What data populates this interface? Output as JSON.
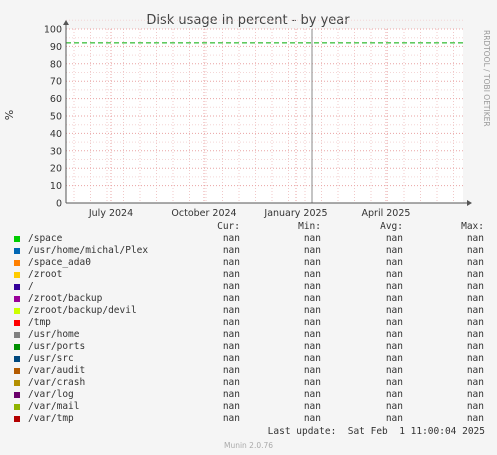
{
  "chart_data": {
    "type": "line",
    "title": "Disk usage in percent - by year",
    "ylabel": "%",
    "ylim": [
      0,
      100
    ],
    "yticks": [
      0,
      10,
      20,
      30,
      40,
      50,
      60,
      70,
      80,
      90,
      100
    ],
    "x_ticks": [
      "July 2024",
      "October 2024",
      "January 2025",
      "April 2025"
    ],
    "warning_line": 92,
    "grid": true,
    "series": [
      {
        "name": "/space",
        "color": "#00cc00",
        "cur": "nan",
        "min": "nan",
        "avg": "nan",
        "max": "nan"
      },
      {
        "name": "/usr/home/michal/Plex",
        "color": "#0066b3",
        "cur": "nan",
        "min": "nan",
        "avg": "nan",
        "max": "nan"
      },
      {
        "name": "/space_ada0",
        "color": "#ff8000",
        "cur": "nan",
        "min": "nan",
        "avg": "nan",
        "max": "nan"
      },
      {
        "name": "/zroot",
        "color": "#ffcc00",
        "cur": "nan",
        "min": "nan",
        "avg": "nan",
        "max": "nan"
      },
      {
        "name": "/",
        "color": "#330099",
        "cur": "nan",
        "min": "nan",
        "avg": "nan",
        "max": "nan"
      },
      {
        "name": "/zroot/backup",
        "color": "#990099",
        "cur": "nan",
        "min": "nan",
        "avg": "nan",
        "max": "nan"
      },
      {
        "name": "/zroot/backup/devil",
        "color": "#ccff00",
        "cur": "nan",
        "min": "nan",
        "avg": "nan",
        "max": "nan"
      },
      {
        "name": "/tmp",
        "color": "#ff0000",
        "cur": "nan",
        "min": "nan",
        "avg": "nan",
        "max": "nan"
      },
      {
        "name": "/usr/home",
        "color": "#808080",
        "cur": "nan",
        "min": "nan",
        "avg": "nan",
        "max": "nan"
      },
      {
        "name": "/usr/ports",
        "color": "#008f00",
        "cur": "nan",
        "min": "nan",
        "avg": "nan",
        "max": "nan"
      },
      {
        "name": "/usr/src",
        "color": "#00487d",
        "cur": "nan",
        "min": "nan",
        "avg": "nan",
        "max": "nan"
      },
      {
        "name": "/var/audit",
        "color": "#b35a00",
        "cur": "nan",
        "min": "nan",
        "avg": "nan",
        "max": "nan"
      },
      {
        "name": "/var/crash",
        "color": "#b38f00",
        "cur": "nan",
        "min": "nan",
        "avg": "nan",
        "max": "nan"
      },
      {
        "name": "/var/log",
        "color": "#6b006b",
        "cur": "nan",
        "min": "nan",
        "avg": "nan",
        "max": "nan"
      },
      {
        "name": "/var/mail",
        "color": "#8fb300",
        "cur": "nan",
        "min": "nan",
        "avg": "nan",
        "max": "nan"
      },
      {
        "name": "/var/tmp",
        "color": "#b30000",
        "cur": "nan",
        "min": "nan",
        "avg": "nan",
        "max": "nan"
      }
    ]
  },
  "side_label": "RRDTOOL / TOBI OETIKER",
  "legend_headers": {
    "cur": "Cur:",
    "min": "Min:",
    "avg": "Avg:",
    "max": "Max:"
  },
  "last_update": "Last update:  Sat Feb  1 11:00:04 2025",
  "footer": "Munin 2.0.76"
}
